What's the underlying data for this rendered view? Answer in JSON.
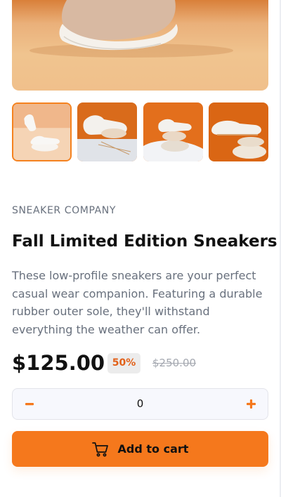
{
  "product": {
    "company": "SNEAKER COMPANY",
    "title": "Fall Limited Edition Sneakers",
    "description": "These low-profile sneakers are your perfect casual wear companion. Featuring a durable rubber outer sole, they'll withstand everything the weather can offer.",
    "price": "$125.00",
    "discount": "50%",
    "original_price": "$250.00"
  },
  "gallery": {
    "selected_index": 0,
    "thumbnails": [
      {
        "icon": "sneaker-on-stone-photo"
      },
      {
        "icon": "sneaker-laces-photo"
      },
      {
        "icon": "sneaker-on-pebbles-photo"
      },
      {
        "icon": "sneaker-side-photo"
      }
    ]
  },
  "quantity": {
    "value": "0",
    "minus_icon": "minus-icon",
    "plus_icon": "plus-icon"
  },
  "cart": {
    "label": "Add to cart",
    "icon": "cart-icon"
  },
  "colors": {
    "accent": "#f5781c",
    "discount_text": "#e2611a",
    "muted_text": "#68707d",
    "dark_text": "#111111"
  }
}
